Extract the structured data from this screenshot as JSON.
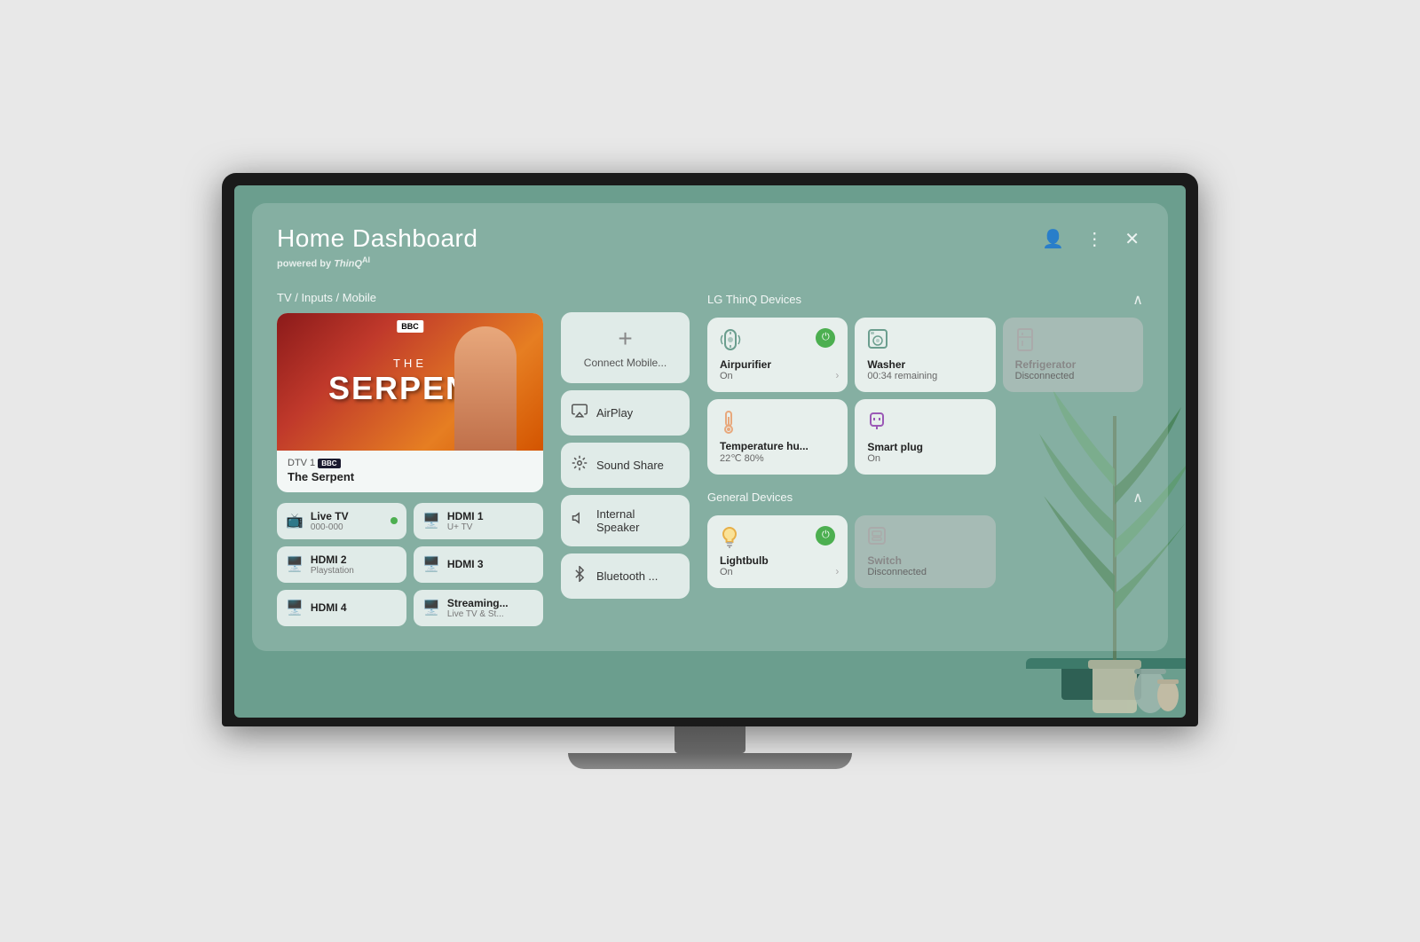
{
  "panel": {
    "title": "Home Dashboard",
    "subtitle_prefix": "powered by ",
    "subtitle_brand": "ThinQ",
    "subtitle_ai": "AI"
  },
  "actions": {
    "user_icon": "👤",
    "menu_icon": "⋮",
    "close_icon": "✕"
  },
  "tv_section": {
    "label": "TV / Inputs / Mobile",
    "show": {
      "channel": "DTV 1",
      "channel_badge": "BBC",
      "show_name": "The Serpent",
      "the_word": "THE",
      "main_word": "SERPENT"
    },
    "inputs": [
      {
        "id": "live-tv",
        "name": "Live TV",
        "sub": "000-000",
        "active": true,
        "icon": "📺"
      },
      {
        "id": "hdmi1",
        "name": "HDMI 1",
        "sub": "U+ TV",
        "active": false,
        "icon": "🔌"
      },
      {
        "id": "hdmi2",
        "name": "HDMI 2",
        "sub": "Playstation",
        "active": false,
        "icon": "🔌"
      },
      {
        "id": "hdmi3",
        "name": "HDMI 3",
        "sub": "",
        "active": false,
        "icon": "🔌"
      },
      {
        "id": "hdmi4",
        "name": "HDMI 4",
        "sub": "",
        "active": false,
        "icon": "🔌"
      },
      {
        "id": "streaming",
        "name": "Streaming...",
        "sub": "Live TV & St...",
        "active": false,
        "icon": "🔌"
      }
    ]
  },
  "mobile_actions": [
    {
      "id": "connect-mobile",
      "label": "Connect Mobile...",
      "type": "connect"
    },
    {
      "id": "airplay",
      "label": "AirPlay",
      "icon": "airplay"
    },
    {
      "id": "sound-share",
      "label": "Sound Share",
      "icon": "sound"
    },
    {
      "id": "internal-speaker",
      "label": "Internal Speaker",
      "icon": "speaker"
    },
    {
      "id": "bluetooth",
      "label": "Bluetooth ...",
      "icon": "bluetooth"
    }
  ],
  "lg_thinq": {
    "section_title": "LG ThinQ Devices",
    "devices": [
      {
        "id": "airpurifier",
        "name": "Airpurifier",
        "status": "On",
        "icon": "💨",
        "power": "on",
        "disconnected": false
      },
      {
        "id": "washer",
        "name": "Washer",
        "status": "00:34 remaining",
        "icon": "🫧",
        "power": "on",
        "disconnected": false
      },
      {
        "id": "refrigerator",
        "name": "Refrigerator",
        "status": "Disconnected",
        "icon": "🧊",
        "power": "off",
        "disconnected": true
      },
      {
        "id": "temperature",
        "name": "Temperature hu...",
        "status": "22℃ 80%",
        "icon": "🌡️",
        "power": "off",
        "disconnected": false
      },
      {
        "id": "smart-plug",
        "name": "Smart plug",
        "status": "On",
        "icon": "🔌",
        "power": "on",
        "disconnected": false
      }
    ]
  },
  "general_devices": {
    "section_title": "General Devices",
    "devices": [
      {
        "id": "lightbulb",
        "name": "Lightbulb",
        "status": "On",
        "icon": "💡",
        "power": "on",
        "disconnected": false
      },
      {
        "id": "switch",
        "name": "Switch",
        "status": "Disconnected",
        "icon": "🔲",
        "power": "off",
        "disconnected": true
      }
    ]
  }
}
